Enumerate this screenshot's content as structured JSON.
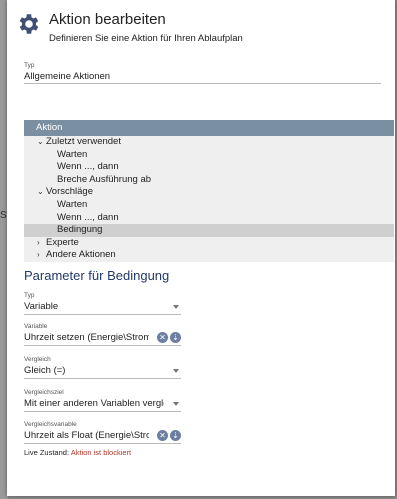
{
  "backdrop": {
    "letter": "S"
  },
  "header": {
    "title": "Aktion bearbeiten",
    "subtitle": "Definieren Sie eine Aktion für Ihren Ablaufplan",
    "icon": "gear-icon"
  },
  "typ_field": {
    "label": "Typ",
    "value": "Allgemeine Aktionen"
  },
  "tree": {
    "header": "Aktion",
    "items": [
      {
        "label": "Zuletzt verwendet",
        "expanded": true
      },
      {
        "label": "Warten"
      },
      {
        "label": "Wenn ..., dann"
      },
      {
        "label": "Breche Ausführung ab"
      },
      {
        "label": "Vorschläge",
        "expanded": true
      },
      {
        "label": "Warten"
      },
      {
        "label": "Wenn ..., dann"
      },
      {
        "label": "Bedingung",
        "selected": true
      },
      {
        "label": "Experte",
        "expanded": false
      },
      {
        "label": "Andere Aktionen",
        "expanded": false
      }
    ]
  },
  "params": {
    "title": "Parameter für Bedingung",
    "typ": {
      "label": "Typ",
      "value": "Variable"
    },
    "variable": {
      "label": "Variable",
      "value": "Uhrzeit setzen (Energie\\Strompreise"
    },
    "vergleich": {
      "label": "Vergleich",
      "value": "Gleich (=)"
    },
    "vergleichsziel": {
      "label": "Vergleichsziel",
      "value": "Mit einer anderen Variablen vergleichen"
    },
    "vergleichsvariable": {
      "label": "Vergleichsvariable",
      "value": "Uhrzeit als Float (Energie\\Strompreise"
    }
  },
  "live": {
    "label": "Live Zustand:",
    "status": "Aktion ist blockiert"
  },
  "colors": {
    "accent": "#223a66",
    "tree_header": "#7b8fa3",
    "blocked": "#b7372b"
  }
}
